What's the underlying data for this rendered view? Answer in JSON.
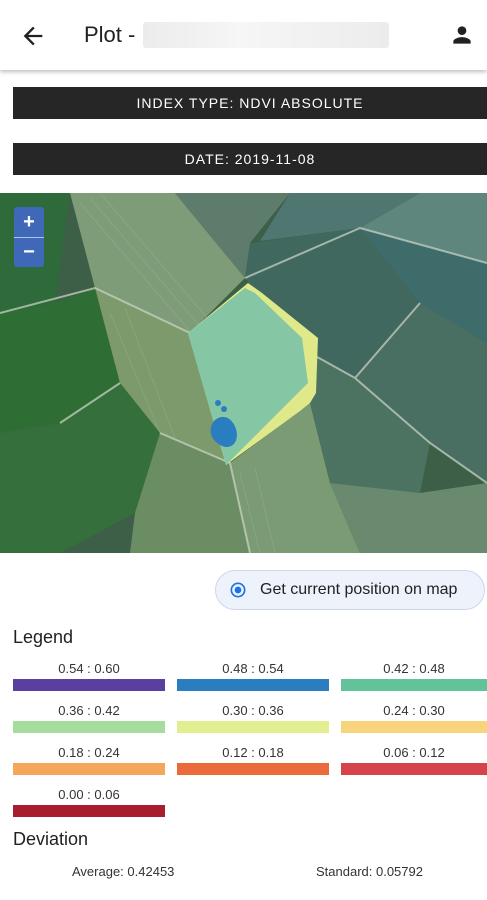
{
  "appbar": {
    "title": "Plot -",
    "back_icon": "arrow-back-icon",
    "profile_icon": "person-icon"
  },
  "info": {
    "index_type": "INDEX TYPE: NDVI ABSOLUTE",
    "date": "DATE: 2019-11-08"
  },
  "map": {
    "zoom_in": "+",
    "zoom_out": "−"
  },
  "position_button": {
    "label": "Get current position on map",
    "icon": "my-location-icon"
  },
  "legend": {
    "title": "Legend",
    "items": [
      {
        "label": "0.54 : 0.60",
        "color": "#5a3fa0"
      },
      {
        "label": "0.48 : 0.54",
        "color": "#2a7dbf"
      },
      {
        "label": "0.42 : 0.48",
        "color": "#62c39b"
      },
      {
        "label": "0.36 : 0.42",
        "color": "#a7dc9f"
      },
      {
        "label": "0.30 : 0.36",
        "color": "#e2ee8f"
      },
      {
        "label": "0.24 : 0.30",
        "color": "#f8d57c"
      },
      {
        "label": "0.18 : 0.24",
        "color": "#f4a659"
      },
      {
        "label": "0.12 : 0.18",
        "color": "#ea6a3c"
      },
      {
        "label": "0.06 : 0.12",
        "color": "#d6434b"
      },
      {
        "label": "0.00 : 0.06",
        "color": "#a81d2d"
      }
    ]
  },
  "deviation": {
    "title": "Deviation",
    "average": "Average: 0.42453",
    "standard": "Standard: 0.05792"
  }
}
